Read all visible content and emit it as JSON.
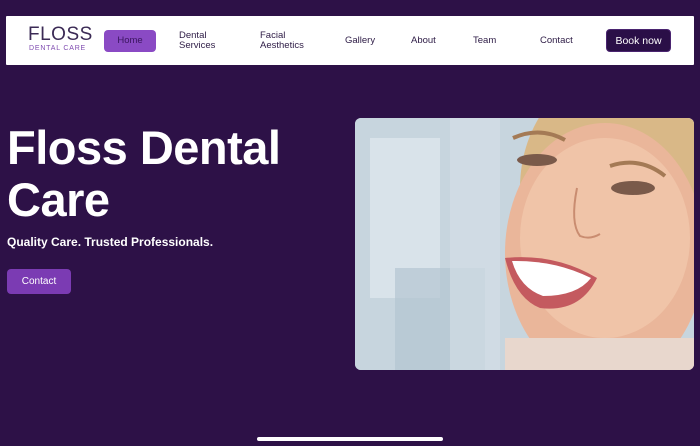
{
  "brand": {
    "name": "FLOSS",
    "tagline": "DENTAL CARE"
  },
  "nav": {
    "items": [
      {
        "label": "Home"
      },
      {
        "label": "Dental Services"
      },
      {
        "label": "Facial Aesthetics"
      },
      {
        "label": "Gallery"
      },
      {
        "label": "About"
      },
      {
        "label": "Team"
      },
      {
        "label": "Contact"
      }
    ],
    "book_label": "Book now"
  },
  "hero": {
    "title": "Floss Dental Care",
    "subtitle": "Quality Care. Trusted Professionals.",
    "cta_label": "Contact",
    "image_description": "smiling-woman-at-dentist"
  },
  "colors": {
    "background": "#2d1147",
    "accent": "#7b3bb3",
    "nav_bg": "#ffffff"
  }
}
